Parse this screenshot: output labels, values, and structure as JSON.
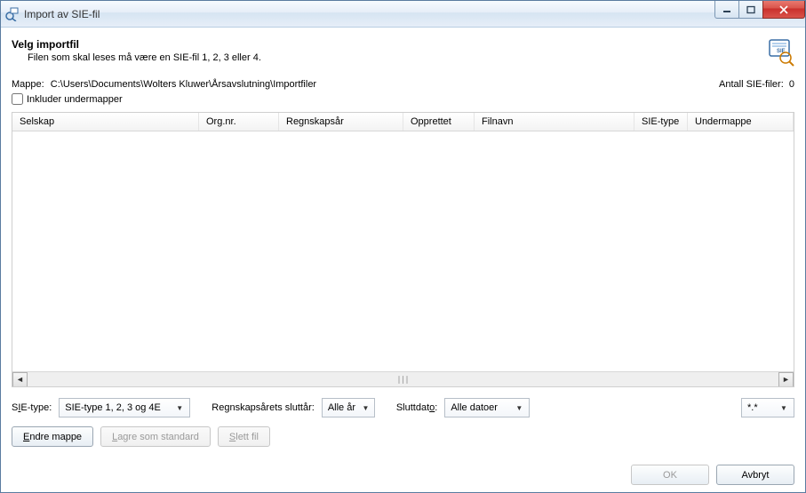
{
  "window": {
    "title": "Import av SIE-fil"
  },
  "header": {
    "title": "Velg importfil",
    "description": "Filen som skal leses må være en SIE-fil 1, 2, 3 eller 4."
  },
  "folder": {
    "label": "Mappe:",
    "path": "C:\\Users\\Documents\\Wolters Kluwer\\Årsavslutning\\Importfiler",
    "include_sub_label": "Inkluder undermapper",
    "count_label": "Antall SIE-filer:",
    "count_value": "0"
  },
  "grid": {
    "columns": {
      "selskap": "Selskap",
      "orgnr": "Org.nr.",
      "regnskap": "Regnskapsår",
      "opprettet": "Opprettet",
      "filnavn": "Filnavn",
      "sietype": "SIE-type",
      "undermappe": "Undermappe"
    }
  },
  "filters": {
    "type_label_pre": "S",
    "type_label_ul": "I",
    "type_label_post": "E-type:",
    "type_value": "SIE-type 1, 2, 3 og 4E",
    "year_label": "Regnskapsårets sluttår:",
    "year_value": "Alle år",
    "date_label_pre": "Sluttdat",
    "date_label_ul": "o",
    "date_label_post": ":",
    "date_value": "Alle datoer",
    "ext_value": "*.*"
  },
  "actions": {
    "change_folder_ul": "E",
    "change_folder_post": "ndre mappe",
    "save_default_ul": "L",
    "save_default_post": "agre som standard",
    "delete_ul": "S",
    "delete_post": "lett fil"
  },
  "dialog": {
    "ok": "OK",
    "cancel": "Avbryt"
  }
}
